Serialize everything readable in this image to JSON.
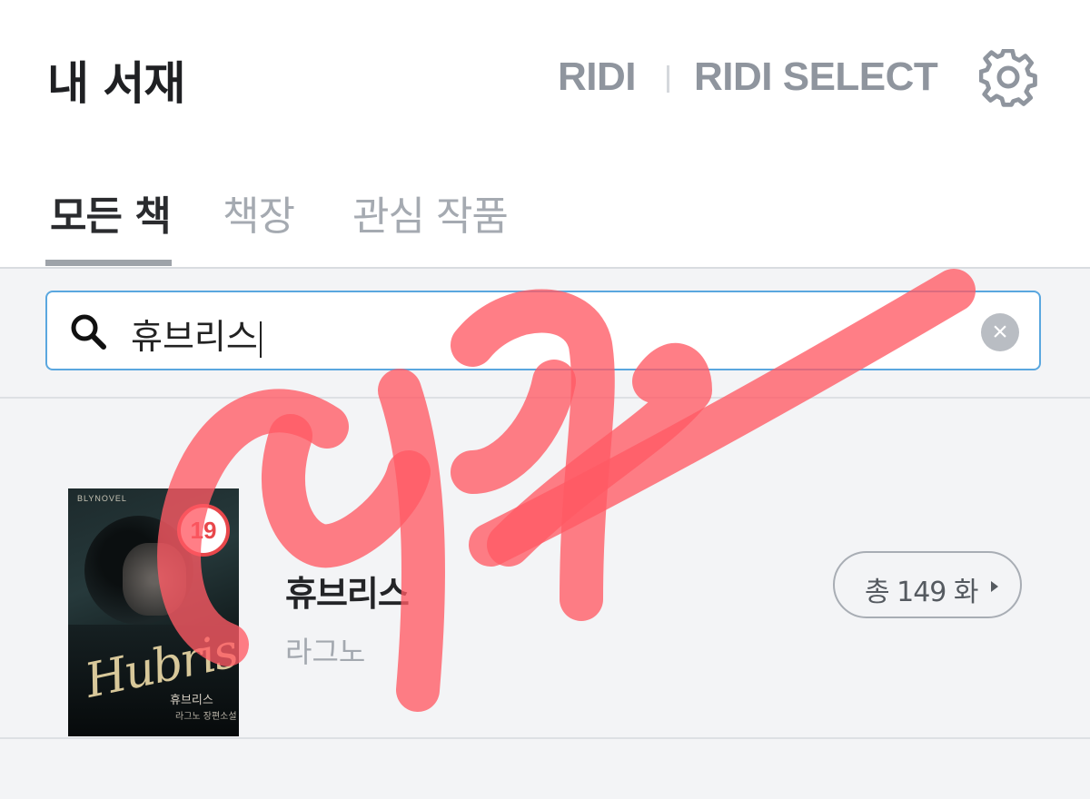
{
  "header": {
    "title": "내 서재",
    "brand_ridi": "RIDI",
    "brand_select": "RIDI SELECT"
  },
  "tabs": [
    {
      "label": "모든 책",
      "active": true
    },
    {
      "label": "책장",
      "active": false
    },
    {
      "label": "관심 작품",
      "active": false
    }
  ],
  "search": {
    "query": "휴브리스",
    "accent_color": "#5aa7df"
  },
  "results": [
    {
      "title": "휴브리스",
      "author": "라그노",
      "age_badge": "19",
      "episodes_label": "총 149 화",
      "cover": {
        "publisher": "BLYNOVEL",
        "script_title": "Hubris",
        "korean_title": "휴브리스",
        "author": "라그노 장편소설"
      }
    }
  ],
  "colors": {
    "badge_red": "#e8474b",
    "scribble": "#ff5a64"
  },
  "icons": {
    "settings": "gear-icon",
    "search": "search-icon",
    "clear": "clear-icon",
    "arrow": "chevron-right-icon"
  }
}
